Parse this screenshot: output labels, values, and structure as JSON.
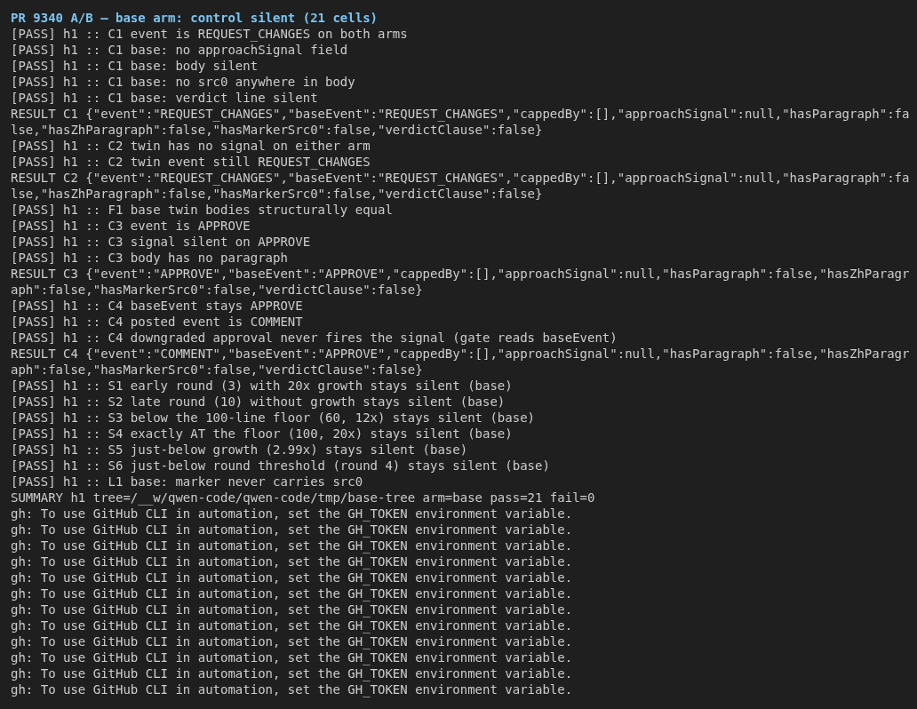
{
  "terminal": {
    "title": "PR 9340 A/B — base arm: control silent (21 cells)",
    "lines": [
      "[PASS] h1 :: C1 event is REQUEST_CHANGES on both arms",
      "[PASS] h1 :: C1 base: no approachSignal field",
      "[PASS] h1 :: C1 base: body silent",
      "[PASS] h1 :: C1 base: no src0 anywhere in body",
      "[PASS] h1 :: C1 base: verdict line silent",
      "RESULT C1 {\"event\":\"REQUEST_CHANGES\",\"baseEvent\":\"REQUEST_CHANGES\",\"cappedBy\":[],\"approachSignal\":null,\"hasParagraph\":false,\"hasZhParagraph\":false,\"hasMarkerSrc0\":false,\"verdictClause\":false}",
      "[PASS] h1 :: C2 twin has no signal on either arm",
      "[PASS] h1 :: C2 twin event still REQUEST_CHANGES",
      "RESULT C2 {\"event\":\"REQUEST_CHANGES\",\"baseEvent\":\"REQUEST_CHANGES\",\"cappedBy\":[],\"approachSignal\":null,\"hasParagraph\":false,\"hasZhParagraph\":false,\"hasMarkerSrc0\":false,\"verdictClause\":false}",
      "[PASS] h1 :: F1 base twin bodies structurally equal",
      "[PASS] h1 :: C3 event is APPROVE",
      "[PASS] h1 :: C3 signal silent on APPROVE",
      "[PASS] h1 :: C3 body has no paragraph",
      "RESULT C3 {\"event\":\"APPROVE\",\"baseEvent\":\"APPROVE\",\"cappedBy\":[],\"approachSignal\":null,\"hasParagraph\":false,\"hasZhParagraph\":false,\"hasMarkerSrc0\":false,\"verdictClause\":false}",
      "[PASS] h1 :: C4 baseEvent stays APPROVE",
      "[PASS] h1 :: C4 posted event is COMMENT",
      "[PASS] h1 :: C4 downgraded approval never fires the signal (gate reads baseEvent)",
      "RESULT C4 {\"event\":\"COMMENT\",\"baseEvent\":\"APPROVE\",\"cappedBy\":[],\"approachSignal\":null,\"hasParagraph\":false,\"hasZhParagraph\":false,\"hasMarkerSrc0\":false,\"verdictClause\":false}",
      "[PASS] h1 :: S1 early round (3) with 20x growth stays silent (base)",
      "[PASS] h1 :: S2 late round (10) without growth stays silent (base)",
      "[PASS] h1 :: S3 below the 100-line floor (60, 12x) stays silent (base)",
      "[PASS] h1 :: S4 exactly AT the floor (100, 20x) stays silent (base)",
      "[PASS] h1 :: S5 just-below growth (2.99x) stays silent (base)",
      "[PASS] h1 :: S6 just-below round threshold (round 4) stays silent (base)",
      "[PASS] h1 :: L1 base: marker never carries src0",
      "SUMMARY h1 tree=/__w/qwen-code/qwen-code/tmp/base-tree arm=base pass=21 fail=0",
      "gh: To use GitHub CLI in automation, set the GH_TOKEN environment variable.",
      "gh: To use GitHub CLI in automation, set the GH_TOKEN environment variable.",
      "gh: To use GitHub CLI in automation, set the GH_TOKEN environment variable.",
      "gh: To use GitHub CLI in automation, set the GH_TOKEN environment variable.",
      "gh: To use GitHub CLI in automation, set the GH_TOKEN environment variable.",
      "gh: To use GitHub CLI in automation, set the GH_TOKEN environment variable.",
      "gh: To use GitHub CLI in automation, set the GH_TOKEN environment variable.",
      "gh: To use GitHub CLI in automation, set the GH_TOKEN environment variable.",
      "gh: To use GitHub CLI in automation, set the GH_TOKEN environment variable.",
      "gh: To use GitHub CLI in automation, set the GH_TOKEN environment variable.",
      "gh: To use GitHub CLI in automation, set the GH_TOKEN environment variable.",
      "gh: To use GitHub CLI in automation, set the GH_TOKEN environment variable."
    ]
  }
}
